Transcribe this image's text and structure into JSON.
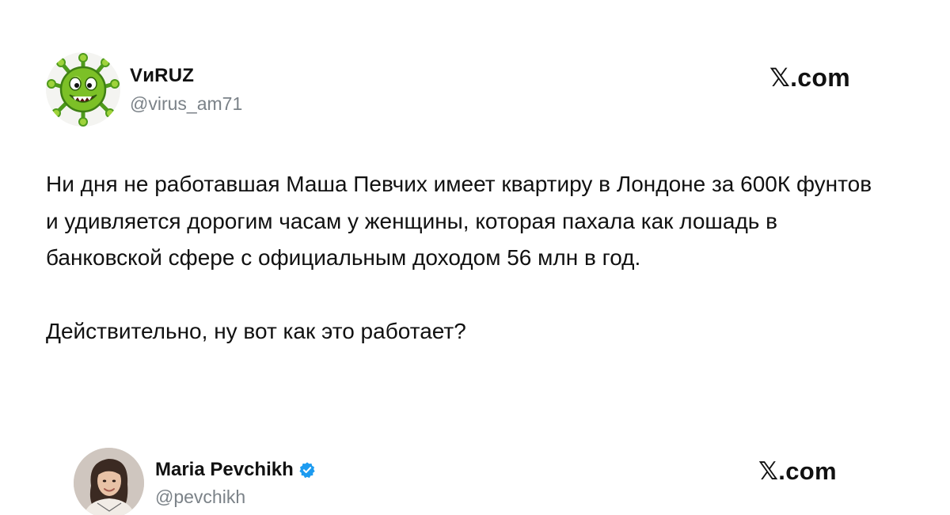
{
  "tweet": {
    "author_name": "VиRUZ",
    "author_handle": "@virus_am71",
    "brand": "𝕏.com",
    "avatar_icon": "green-virus-monster-icon",
    "text_paragraph_1": "Ни дня не работавшая Маша Певчих имеет квартиру в Лондоне за 600К фунтов и удивляется дорогим часам у женщины, которая пахала как лошадь в банковской сфере с официальным доходом 56 млн в год.",
    "text_paragraph_2": "Действительно, ну вот как это работает?"
  },
  "quoted_tweet": {
    "author_name": "Maria Pevchikh",
    "author_handle": "@pevchikh",
    "brand": "𝕏.com",
    "verified_icon": "verified-badge-icon",
    "verified_color": "#1d9bf0",
    "avatar_icon": "woman-portrait-photo"
  }
}
